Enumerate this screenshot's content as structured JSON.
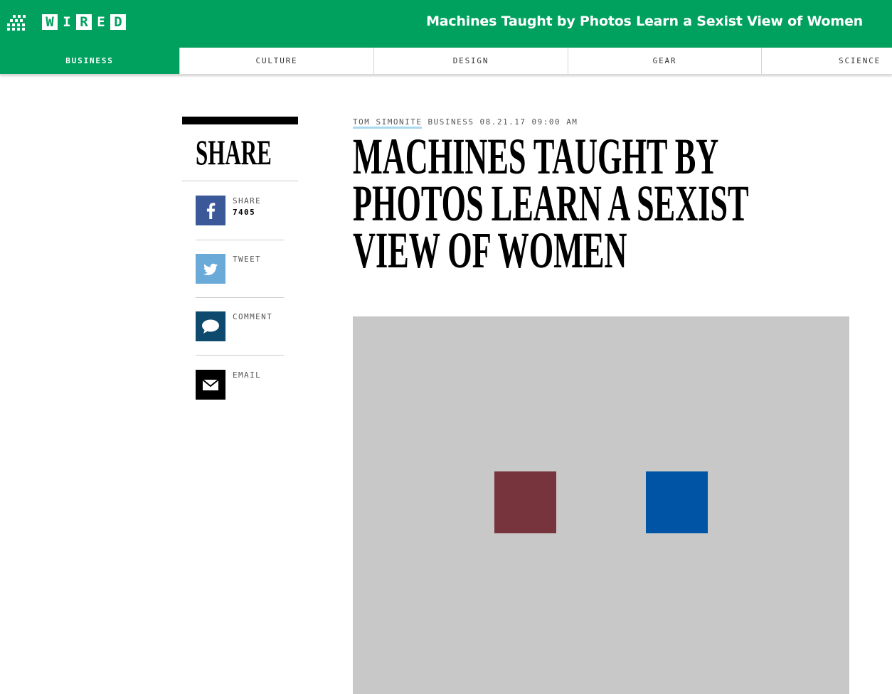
{
  "header": {
    "logo_letters": [
      "W",
      "I",
      "R",
      "E",
      "D"
    ],
    "title": "Machines Taught by Photos Learn a Sexist View of Women",
    "menu_icon": "grid-menu-icon"
  },
  "nav": {
    "tabs": [
      {
        "label": "BUSINESS",
        "active": true
      },
      {
        "label": "CULTURE",
        "active": false
      },
      {
        "label": "DESIGN",
        "active": false
      },
      {
        "label": "GEAR",
        "active": false
      },
      {
        "label": "SCIENCE",
        "active": false
      }
    ]
  },
  "share": {
    "heading": "SHARE",
    "items": [
      {
        "icon": "facebook-icon",
        "label": "SHARE",
        "count": "7405"
      },
      {
        "icon": "twitter-icon",
        "label": "TWEET"
      },
      {
        "icon": "comment-icon",
        "label": "COMMENT"
      },
      {
        "icon": "email-icon",
        "label": "EMAIL"
      }
    ]
  },
  "article": {
    "author": "TOM SIMONITE",
    "category": "BUSINESS",
    "date": "08.21.17",
    "time": "09:00 AM",
    "title": "Machines Taught by Photos Learn a Sexist View of Women"
  },
  "colors": {
    "brand_green": "#00a05f",
    "facebook": "#3b5998",
    "twitter": "#6aaad8",
    "comment": "#0d4a6d",
    "email": "#000000",
    "author_underline": "#a9d8f0",
    "hero_bg": "#c8c8c8",
    "hero_square_left": "#77343c",
    "hero_square_right": "#0054a6"
  }
}
